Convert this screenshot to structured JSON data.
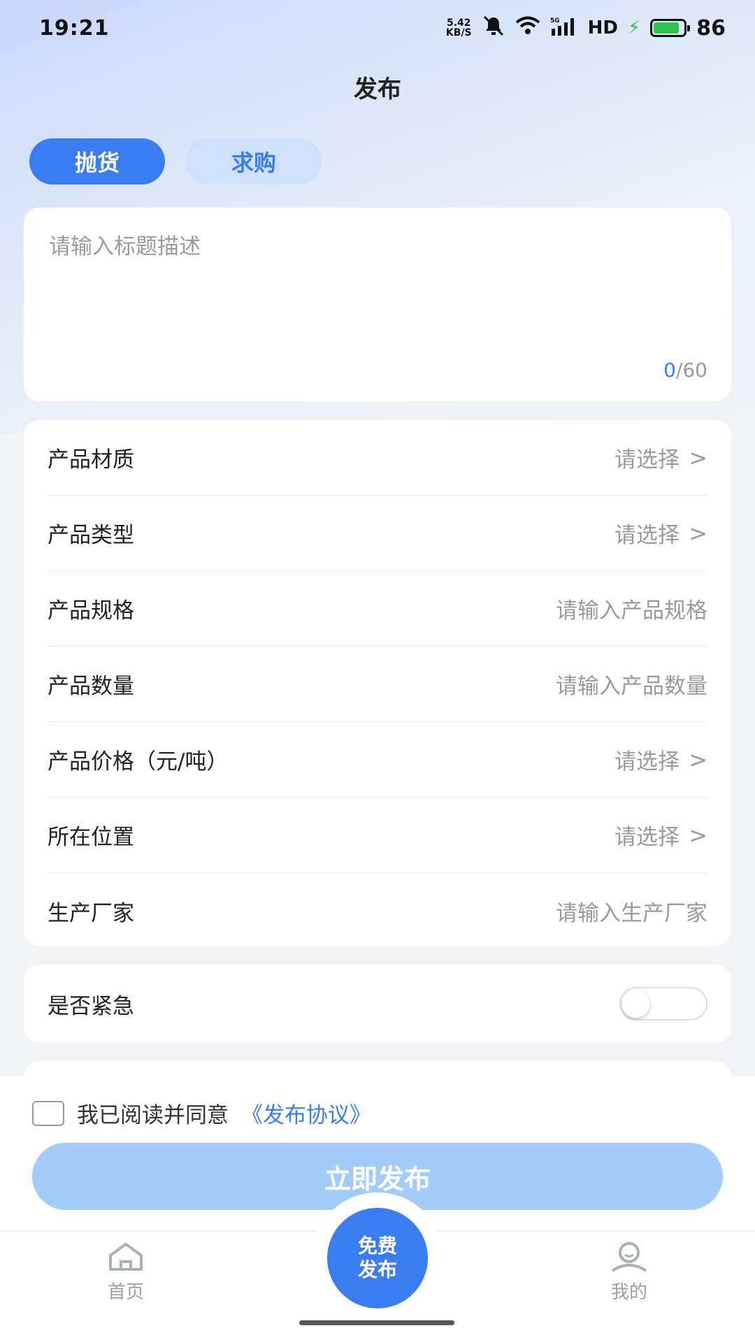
{
  "status_bar": {
    "time": "19:21",
    "net_speed_value": "5.42",
    "net_speed_unit": "KB/S",
    "network_type": "5G",
    "hd": "HD",
    "battery": "86",
    "battery_color": "#2fc24f"
  },
  "header": {
    "title": "发布"
  },
  "tabs": [
    {
      "label": "抛货",
      "active": true
    },
    {
      "label": "求购",
      "active": false
    }
  ],
  "title_input": {
    "placeholder": "请输入标题描述",
    "count_current": "0",
    "count_max": "/60"
  },
  "form": {
    "rows": [
      {
        "label": "产品材质",
        "value": "请选择",
        "type": "select"
      },
      {
        "label": "产品类型",
        "value": "请选择",
        "type": "select"
      },
      {
        "label": "产品规格",
        "value": "请输入产品规格",
        "type": "input"
      },
      {
        "label": "产品数量",
        "value": "请输入产品数量",
        "type": "input"
      },
      {
        "label": "产品价格（元/吨）",
        "value": "请选择",
        "type": "select"
      },
      {
        "label": "所在位置",
        "value": "请选择",
        "type": "select"
      },
      {
        "label": "生产厂家",
        "value": "请输入生产厂家",
        "type": "input"
      }
    ]
  },
  "urgent": {
    "label": "是否紧急",
    "enabled": false
  },
  "agreement": {
    "text": "我已阅读并同意",
    "link": "《发布协议》",
    "checked": false
  },
  "publish_button": {
    "label": "立即发布"
  },
  "tabbar": {
    "home_label": "首页",
    "center_line1": "免费",
    "center_line2": "发布",
    "mine_label": "我的"
  },
  "colors": {
    "accent": "#3a7df3",
    "accent_light": "#cfe0fb",
    "button_disabled": "#a3ccfa"
  }
}
